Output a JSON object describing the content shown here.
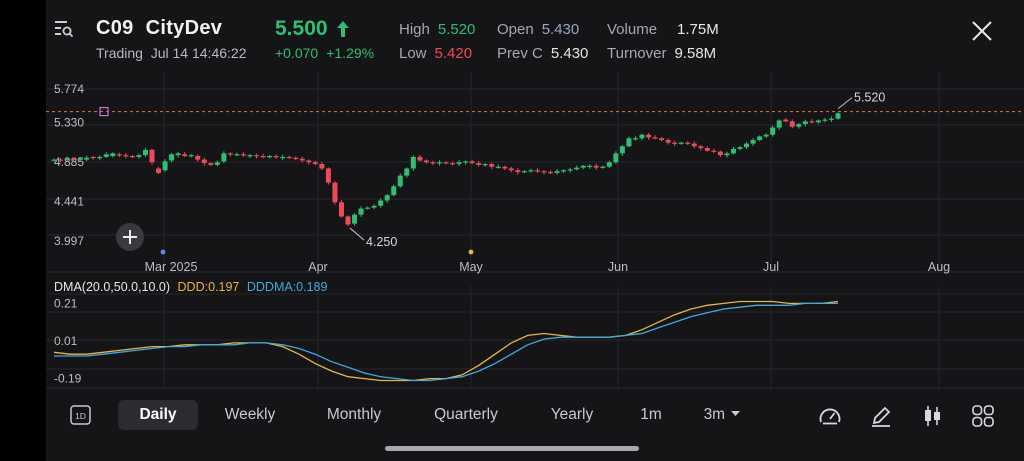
{
  "header": {
    "symbol": "C09",
    "name": "CityDev",
    "status": "Trading",
    "datetime": "Jul 14 14:46:22",
    "price": "5.500",
    "change": "+0.070",
    "change_pct": "+1.29%",
    "stats": [
      {
        "label": "High",
        "value": "5.520",
        "color": "#2fbf71"
      },
      {
        "label": "Low",
        "value": "5.420",
        "color": "#f04a5a"
      },
      {
        "label": "Open",
        "value": "5.430",
        "color": "#9aa6c8"
      },
      {
        "label": "Prev C",
        "value": "5.430",
        "color": "#e6e6e6"
      },
      {
        "label": "Volume",
        "value": "1.75M",
        "color": "#e6e6e6"
      },
      {
        "label": "Turnover",
        "value": "9.58M",
        "color": "#e6e6e6"
      }
    ],
    "icons": {
      "menu": "list-search-icon",
      "close": "close-icon"
    }
  },
  "chart_data": [
    {
      "type": "candlestick",
      "y_ticks": [
        "5.774",
        "5.330",
        "4.885",
        "4.441",
        "3.997"
      ],
      "ylim": [
        3.997,
        5.774
      ],
      "x_ticks": [
        "Mar 2025",
        "Apr",
        "May",
        "Jun",
        "Jul",
        "Aug"
      ],
      "price_line": 5.52,
      "annotations": [
        "5.520",
        "4.250"
      ],
      "colors": {
        "up": "#2fbf71",
        "down": "#f04a5a",
        "price_line": "#e0603a"
      },
      "closes": [
        4.98,
        4.97,
        4.99,
        4.98,
        4.99,
        5.0,
        5.0,
        5.01,
        5.04,
        5.05,
        5.03,
        5.02,
        5.01,
        5.03,
        5.09,
        4.95,
        4.83,
        4.96,
        5.04,
        5.05,
        5.02,
        5.03,
        4.98,
        4.94,
        4.92,
        4.95,
        5.05,
        5.04,
        5.04,
        5.03,
        5.03,
        5.02,
        5.01,
        5.02,
        5.01,
        5.01,
        5.0,
        4.99,
        4.97,
        4.95,
        4.93,
        4.88,
        4.72,
        4.5,
        4.34,
        4.25,
        4.36,
        4.43,
        4.44,
        4.46,
        4.52,
        4.58,
        4.68,
        4.8,
        4.88,
        5.01,
        4.97,
        4.95,
        4.94,
        4.95,
        4.94,
        4.93,
        4.95,
        4.96,
        4.94,
        4.92,
        4.93,
        4.9,
        4.9,
        4.88,
        4.86,
        4.84,
        4.85,
        4.86,
        4.85,
        4.84,
        4.83,
        4.85,
        4.86,
        4.87,
        4.89,
        4.91,
        4.91,
        4.89,
        4.9,
        4.95,
        5.05,
        5.13,
        5.22,
        5.22,
        5.26,
        5.23,
        5.22,
        5.2,
        5.17,
        5.16,
        5.17,
        5.16,
        5.13,
        5.11,
        5.08,
        5.07,
        5.03,
        5.05,
        5.1,
        5.12,
        5.16,
        5.2,
        5.24,
        5.26,
        5.34,
        5.42,
        5.41,
        5.35,
        5.38,
        5.41,
        5.4,
        5.42,
        5.43,
        5.44,
        5.5
      ],
      "opens_delta": [
        0.01,
        -0.01,
        0.01,
        -0.01,
        0.01,
        0.02,
        -0.01,
        0.01,
        0.03,
        0.03,
        -0.01,
        -0.01,
        -0.01,
        0.02,
        0.06,
        -0.14,
        -0.05,
        0.1,
        0.07,
        0.02,
        -0.02,
        0.01,
        -0.04,
        -0.04,
        -0.02,
        0.03,
        0.09,
        -0.01,
        0.01,
        -0.01,
        0.01,
        -0.01,
        -0.01,
        0.01,
        -0.01,
        0.01,
        -0.01,
        -0.01,
        -0.02,
        -0.02,
        -0.02,
        -0.05,
        -0.16,
        -0.22,
        -0.16,
        -0.09,
        0.1,
        0.07,
        0.01,
        0.02,
        0.06,
        0.06,
        0.1,
        0.12,
        0.08,
        0.13,
        -0.04,
        -0.02,
        -0.01,
        0.01,
        -0.01,
        -0.01,
        0.02,
        0.01,
        -0.02,
        -0.02,
        0.01,
        -0.03,
        0.01,
        -0.02,
        -0.02,
        -0.02,
        0.01,
        0.01,
        -0.01,
        -0.01,
        -0.01,
        0.02,
        0.01,
        0.01,
        0.02,
        0.02,
        0.01,
        -0.02,
        0.01,
        0.05,
        0.1,
        0.08,
        0.09,
        0.01,
        0.04,
        -0.03,
        -0.01,
        -0.02,
        -0.03,
        -0.01,
        0.01,
        -0.01,
        -0.03,
        -0.02,
        -0.03,
        -0.01,
        -0.04,
        0.02,
        0.05,
        0.02,
        0.04,
        0.04,
        0.04,
        0.02,
        0.08,
        0.08,
        -0.02,
        -0.06,
        0.03,
        0.03,
        -0.01,
        0.02,
        0.01,
        0.01,
        0.06
      ]
    },
    {
      "type": "line",
      "title": "DMA(20.0,50.0,10.0)",
      "series": [
        {
          "name": "DDD:0.197",
          "color": "#e9b640",
          "values": [
            -0.05,
            -0.06,
            -0.06,
            -0.05,
            -0.04,
            -0.03,
            -0.02,
            -0.02,
            -0.01,
            -0.01,
            -0.01,
            0.0,
            0.0,
            0.0,
            -0.02,
            -0.06,
            -0.11,
            -0.15,
            -0.18,
            -0.19,
            -0.2,
            -0.2,
            -0.2,
            -0.19,
            -0.19,
            -0.17,
            -0.12,
            -0.06,
            0.0,
            0.04,
            0.05,
            0.04,
            0.03,
            0.03,
            0.03,
            0.04,
            0.07,
            0.11,
            0.15,
            0.18,
            0.2,
            0.21,
            0.22,
            0.22,
            0.22,
            0.21,
            0.21,
            0.21,
            0.22
          ]
        },
        {
          "name": "DDDMA:0.189",
          "color": "#3fa9e0",
          "values": [
            -0.07,
            -0.07,
            -0.07,
            -0.06,
            -0.05,
            -0.04,
            -0.03,
            -0.02,
            -0.02,
            -0.01,
            -0.01,
            -0.01,
            0.0,
            0.0,
            -0.01,
            -0.03,
            -0.06,
            -0.1,
            -0.13,
            -0.16,
            -0.18,
            -0.19,
            -0.2,
            -0.2,
            -0.19,
            -0.18,
            -0.15,
            -0.11,
            -0.06,
            -0.01,
            0.02,
            0.03,
            0.03,
            0.03,
            0.03,
            0.04,
            0.05,
            0.08,
            0.11,
            0.14,
            0.16,
            0.18,
            0.19,
            0.2,
            0.2,
            0.2,
            0.21,
            0.21,
            0.21
          ]
        }
      ],
      "y_ticks": [
        "0.21",
        "0.01",
        "-0.19"
      ],
      "ylim": [
        -0.24,
        0.26
      ]
    }
  ],
  "timeframes": {
    "items": [
      "Daily",
      "Weekly",
      "Monthly",
      "Quarterly",
      "Yearly",
      "1m",
      "3m"
    ],
    "active": "Daily",
    "intraday_label": "1D"
  },
  "toolbar_icons": [
    "gauge-icon",
    "pen-icon",
    "candlestick-icon",
    "grid-icon"
  ]
}
